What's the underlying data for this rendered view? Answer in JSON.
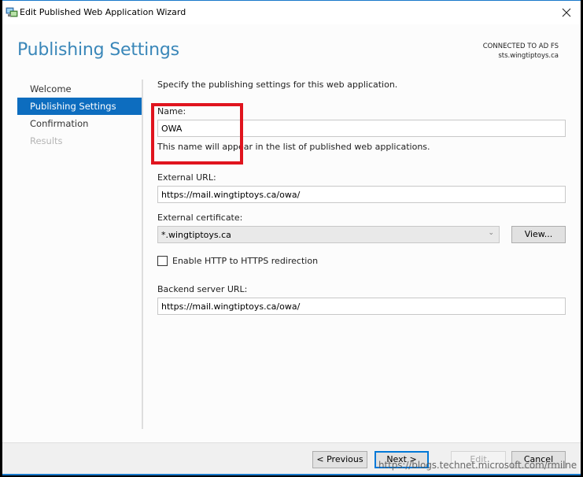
{
  "window": {
    "title": "Edit Published Web Application Wizard",
    "close_icon": "close-icon",
    "app_icon": "wizard-app-icon"
  },
  "header": {
    "title": "Publishing Settings",
    "connection_status": "CONNECTED TO AD FS",
    "connection_server": "sts.wingtiptoys.ca"
  },
  "sidebar": {
    "items": [
      {
        "label": "Welcome",
        "state": "normal"
      },
      {
        "label": "Publishing Settings",
        "state": "active"
      },
      {
        "label": "Confirmation",
        "state": "normal"
      },
      {
        "label": "Results",
        "state": "disabled"
      }
    ]
  },
  "form": {
    "intro": "Specify the publishing settings for this web application.",
    "name": {
      "label": "Name:",
      "value": "OWA",
      "hint": "This name will appear in the list of published web applications."
    },
    "external_url": {
      "label": "External URL:",
      "value": "https://mail.wingtiptoys.ca/owa/"
    },
    "external_certificate": {
      "label": "External certificate:",
      "selected": "*.wingtiptoys.ca",
      "view_button": "View..."
    },
    "http_redirect": {
      "label": "Enable HTTP to HTTPS redirection",
      "checked": false
    },
    "backend_url": {
      "label": "Backend server URL:",
      "value": "https://mail.wingtiptoys.ca/owa/"
    }
  },
  "footer": {
    "previous": "< Previous",
    "next": "Next >",
    "edit": "Edit",
    "cancel": "Cancel"
  },
  "annotation": {
    "highlight_color": "#e0141e"
  },
  "watermark": "https://blogs.technet.microsoft.com/rmilne"
}
